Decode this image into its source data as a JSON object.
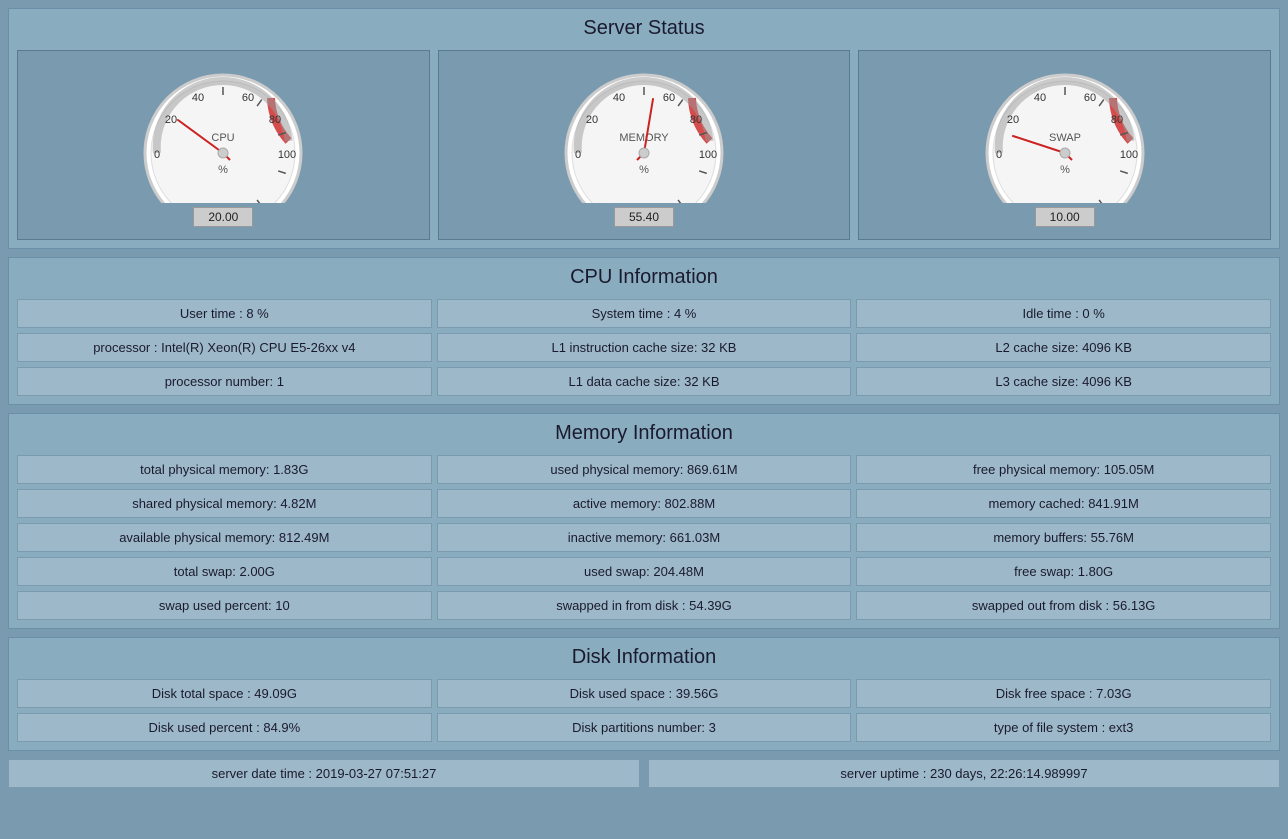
{
  "page": {
    "title": "Server Status"
  },
  "gauges": [
    {
      "label": "CPU",
      "value": 20.0,
      "value_display": "20.00",
      "needle_angle": -60,
      "color": "#cc2222"
    },
    {
      "label": "MEMORY",
      "value": 55.4,
      "value_display": "55.40",
      "needle_angle": 10,
      "color": "#cc2222"
    },
    {
      "label": "SWAP",
      "value": 10.0,
      "value_display": "10.00",
      "needle_angle": -75,
      "color": "#cc2222"
    }
  ],
  "cpu_section": {
    "title": "CPU Information",
    "cells": [
      "User time : 8 %",
      "System time : 4 %",
      "Idle time : 0 %",
      "processor : Intel(R) Xeon(R) CPU E5-26xx v4",
      "L1 instruction cache size: 32 KB",
      "L2 cache size: 4096 KB",
      "processor number: 1",
      "L1 data cache size: 32 KB",
      "L3 cache size: 4096 KB"
    ]
  },
  "memory_section": {
    "title": "Memory Information",
    "cells": [
      "total physical memory: 1.83G",
      "used physical memory: 869.61M",
      "free physical memory: 105.05M",
      "shared physical memory: 4.82M",
      "active memory: 802.88M",
      "memory cached: 841.91M",
      "available physical memory: 812.49M",
      "inactive memory: 661.03M",
      "memory buffers: 55.76M",
      "total swap: 2.00G",
      "used swap: 204.48M",
      "free swap: 1.80G",
      "swap used percent: 10",
      "swapped in from disk : 54.39G",
      "swapped out from disk : 56.13G"
    ]
  },
  "disk_section": {
    "title": "Disk Information",
    "cells": [
      "Disk total space : 49.09G",
      "Disk used space : 39.56G",
      "Disk free space : 7.03G",
      "Disk used percent : 84.9%",
      "Disk partitions number: 3",
      "type of file system : ext3"
    ]
  },
  "status_bar": {
    "datetime": "server date time : 2019-03-27 07:51:27",
    "uptime": "server uptime : 230 days, 22:26:14.989997"
  }
}
